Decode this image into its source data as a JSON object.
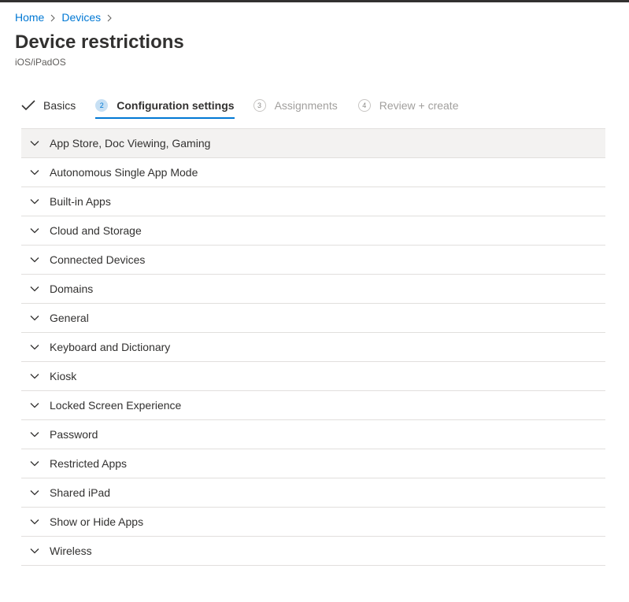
{
  "breadcrumb": {
    "items": [
      "Home",
      "Devices"
    ]
  },
  "page": {
    "title": "Device restrictions",
    "subtitle": "iOS/iPadOS"
  },
  "wizard": {
    "steps": [
      {
        "number": "",
        "label": "Basics",
        "state": "done"
      },
      {
        "number": "2",
        "label": "Configuration settings",
        "state": "active"
      },
      {
        "number": "3",
        "label": "Assignments",
        "state": "pending"
      },
      {
        "number": "4",
        "label": "Review + create",
        "state": "pending"
      }
    ]
  },
  "settings": {
    "items": [
      {
        "label": "App Store, Doc Viewing, Gaming"
      },
      {
        "label": "Autonomous Single App Mode"
      },
      {
        "label": "Built-in Apps"
      },
      {
        "label": "Cloud and Storage"
      },
      {
        "label": "Connected Devices"
      },
      {
        "label": "Domains"
      },
      {
        "label": "General"
      },
      {
        "label": "Keyboard and Dictionary"
      },
      {
        "label": "Kiosk"
      },
      {
        "label": "Locked Screen Experience"
      },
      {
        "label": "Password"
      },
      {
        "label": "Restricted Apps"
      },
      {
        "label": "Shared iPad"
      },
      {
        "label": "Show or Hide Apps"
      },
      {
        "label": "Wireless"
      }
    ]
  },
  "colors": {
    "link": "#0078d4",
    "active_step_circle": "#c7e0f4",
    "row_highlight": "#f3f2f1",
    "divider": "#e1dfdd"
  },
  "icons": {
    "breadcrumb_separator": "chevron-right-icon",
    "step_done": "checkmark-icon",
    "row_expander": "chevron-down-icon"
  }
}
